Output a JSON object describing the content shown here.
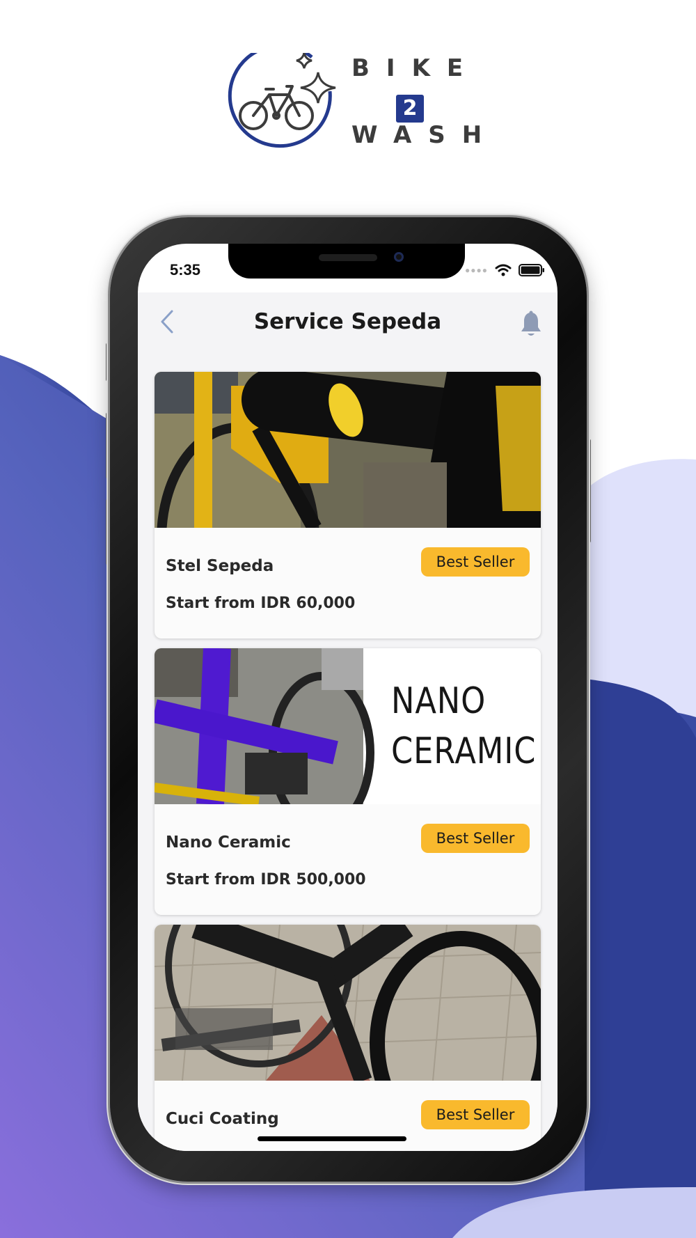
{
  "brand": {
    "line1": "BIKE",
    "number": "2",
    "line3": "WASH",
    "primary_color": "#243a8e",
    "accent_color": "#3c3c3c"
  },
  "status_bar": {
    "time": "5:35",
    "icons": [
      "cellular-dots-icon",
      "wifi-icon",
      "battery-icon"
    ]
  },
  "header": {
    "title": "Service Sepeda",
    "back_icon": "chevron-left-icon",
    "notification_icon": "bell-icon"
  },
  "services": [
    {
      "name": "Stel Sepeda",
      "price": "Start from IDR 60,000",
      "badge": "Best Seller"
    },
    {
      "name": "Nano Ceramic",
      "price": "Start from IDR 500,000",
      "badge": "Best Seller",
      "image_text": [
        "NANO",
        "CERAMIC"
      ]
    },
    {
      "name": "Cuci Coating",
      "price": "",
      "badge": "Best Seller"
    }
  ],
  "colors": {
    "badge": "#f9b92d",
    "wave_dark": "#2e3f94",
    "wave_purple": "#7f6bd6",
    "wave_light": "#dfe1fb"
  }
}
